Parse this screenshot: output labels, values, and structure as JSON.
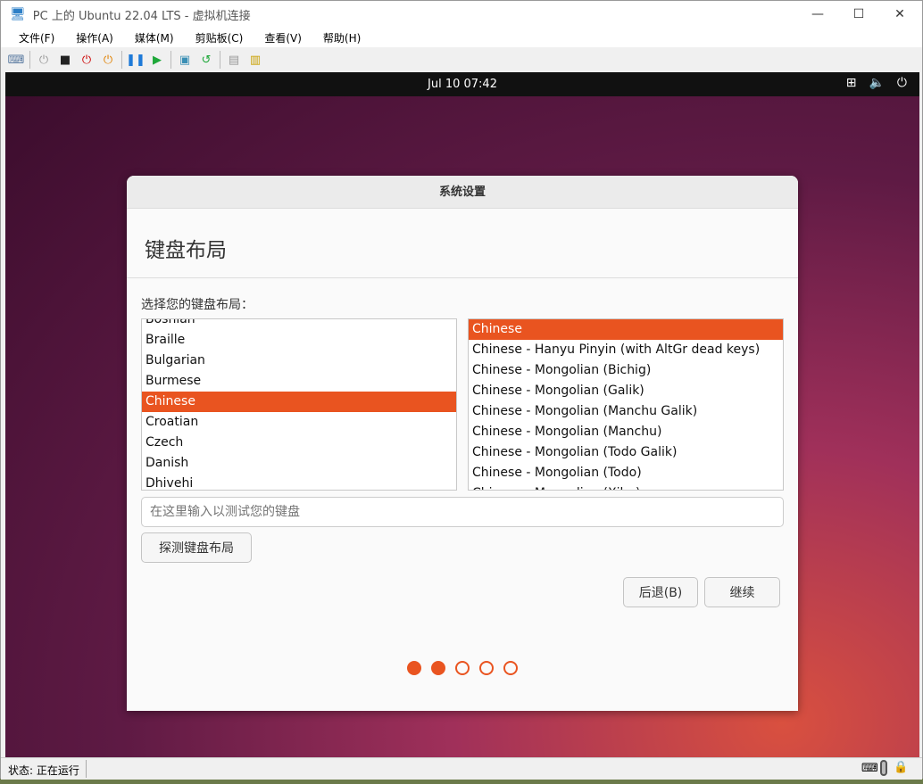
{
  "window": {
    "title": "PC 上的 Ubuntu 22.04 LTS - 虚拟机连接",
    "minimize": "—",
    "maximize": "☐",
    "close": "✕"
  },
  "menu": [
    "文件(F)",
    "操作(A)",
    "媒体(M)",
    "剪贴板(C)",
    "查看(V)",
    "帮助(H)"
  ],
  "toolbar": [
    {
      "icon": "ctrl-alt-del-icon",
      "glyph": "⌨",
      "color": "#5a7aa0"
    },
    {
      "icon": "start-icon",
      "glyph": "⏻",
      "color": "#999"
    },
    {
      "icon": "turn-off-icon",
      "glyph": "■",
      "color": "#222"
    },
    {
      "icon": "shutdown-icon",
      "glyph": "⏻",
      "color": "#cc0000"
    },
    {
      "icon": "save-icon",
      "glyph": "⏻",
      "color": "#e08000"
    },
    {
      "icon": "pause-icon",
      "glyph": "❚❚",
      "color": "#1e7ad8"
    },
    {
      "icon": "resume-icon",
      "glyph": "▶",
      "color": "#1fa83a"
    },
    {
      "icon": "checkpoint-icon",
      "glyph": "▣",
      "color": "#3a8fb5"
    },
    {
      "icon": "revert-icon",
      "glyph": "↺",
      "color": "#1fa83a"
    },
    {
      "icon": "enhanced-session-icon",
      "glyph": "▤",
      "color": "#999"
    },
    {
      "icon": "share-icon",
      "glyph": "▥",
      "color": "#c9a000"
    }
  ],
  "ubuntu_topbar": {
    "clock": "Jul 10  07:42",
    "tray": [
      "network-icon",
      "volume-icon",
      "power-icon"
    ]
  },
  "dialog": {
    "title": "系统设置",
    "heading": "键盘布局",
    "prompt": "选择您的键盘布局：",
    "layouts": [
      "Bosnian",
      "Braille",
      "Bulgarian",
      "Burmese",
      "Chinese",
      "Croatian",
      "Czech",
      "Danish",
      "Dhivehi"
    ],
    "selected_layout": "Chinese",
    "variants": [
      "Chinese",
      "Chinese - Hanyu Pinyin (with AltGr dead keys)",
      "Chinese - Mongolian (Bichig)",
      "Chinese - Mongolian (Galik)",
      "Chinese - Mongolian (Manchu Galik)",
      "Chinese - Mongolian (Manchu)",
      "Chinese - Mongolian (Todo Galik)",
      "Chinese - Mongolian (Todo)",
      "Chinese - Mongolian (Xibe)"
    ],
    "selected_variant": "Chinese",
    "test_placeholder": "在这里输入以测试您的键盘",
    "detect_button": "探测键盘布局",
    "back_button": "后退(B)",
    "continue_button": "继续",
    "progress": {
      "total_steps": 5,
      "current_step": 2
    }
  },
  "statusbar": {
    "label": "状态: 正在运行"
  },
  "colors": {
    "accent": "#e95420"
  }
}
